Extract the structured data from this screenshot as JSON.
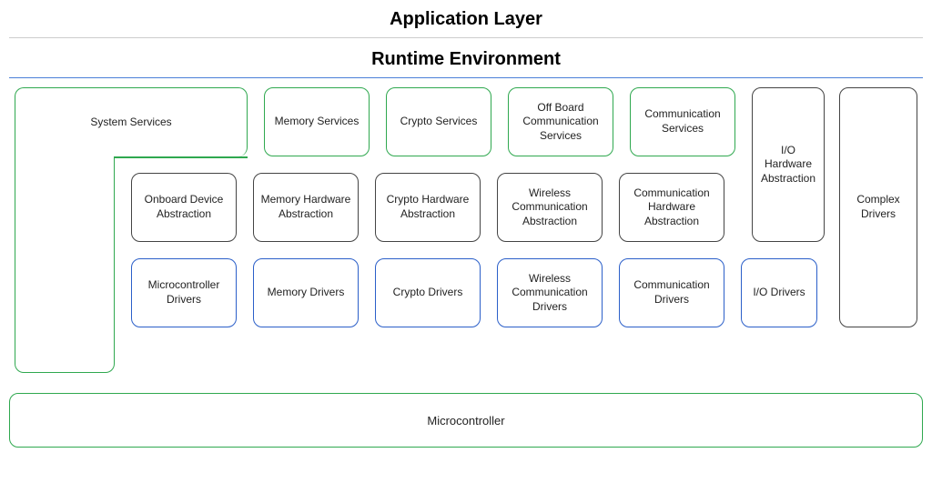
{
  "titles": {
    "app_layer": "Application Layer",
    "runtime": "Runtime Environment"
  },
  "services_row": {
    "system": "System Services",
    "memory": "Memory Services",
    "crypto": "Crypto Services",
    "offboard": "Off Board Communication Services",
    "comm": "Communication Services"
  },
  "abstraction_row": {
    "onboard": "Onboard Device Abstraction",
    "memory": "Memory Hardware Abstraction",
    "crypto": "Crypto Hardware Abstraction",
    "wireless": "Wireless Communication Abstraction",
    "comm": "Communication Hardware Abstraction",
    "io": "I/O Hardware Abstraction"
  },
  "drivers_row": {
    "mcu": "Microcontroller Drivers",
    "memory": "Memory Drivers",
    "crypto": "Crypto Drivers",
    "wireless": "Wireless Communication Drivers",
    "comm": "Communication Drivers",
    "io": "I/O Drivers"
  },
  "side": {
    "complex": "Complex Drivers"
  },
  "microcontroller": "Microcontroller"
}
